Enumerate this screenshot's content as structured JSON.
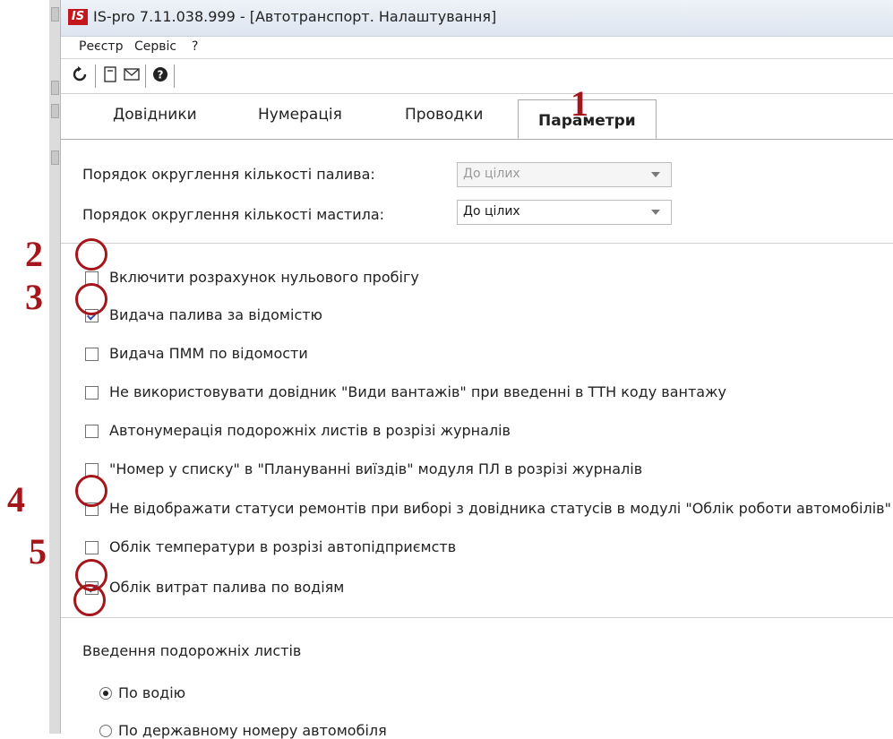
{
  "window": {
    "title": "IS-pro 7.11.038.999 - [Автотранспорт. Налаштування]",
    "logo": "IS"
  },
  "menu": [
    "Реєстр",
    "Сервіс",
    "?"
  ],
  "toolbar": {
    "icons": [
      "refresh-icon",
      "form-icon",
      "mail-icon",
      "help-icon"
    ]
  },
  "tabs": [
    {
      "label": "Довідники",
      "active": false
    },
    {
      "label": "Нумерація",
      "active": false
    },
    {
      "label": "Проводки",
      "active": false
    },
    {
      "label": "Параметри",
      "active": true
    }
  ],
  "settings": {
    "fuel_rounding": {
      "label": "Порядок округлення кількості палива:",
      "value": "До цілих",
      "enabled": false
    },
    "oil_rounding": {
      "label": "Порядок округлення кількості мастила:",
      "value": "До цілих",
      "enabled": true
    }
  },
  "checkboxes": [
    {
      "label": "Включити розрахунок нульового пробігу",
      "checked": false
    },
    {
      "label": "Видача палива за відомістю",
      "checked": true
    },
    {
      "label": "Видача ПММ по відомости",
      "checked": false
    },
    {
      "label": "Не використовувати довідник \"Види вантажів\" при введенні в ТТН коду вантажу",
      "checked": false
    },
    {
      "label": "Автонумерація подорожніх листів в розрізі журналів",
      "checked": false
    },
    {
      "label": "\"Номер у списку\" в \"Плануванні виїздів\" модуля ПЛ в розрізі журналів",
      "checked": false
    },
    {
      "label": "Не відображати статуси ремонтів при виборі з довідника статусів в модулі \"Облік роботи автомобілів\"",
      "checked": false
    },
    {
      "label": "Облік температури в розрізі автопідприємств",
      "checked": false
    },
    {
      "label": "Облік витрат палива по водіям",
      "checked": true
    }
  ],
  "waybill_entry": {
    "label": "Введення подорожніх листів",
    "options": [
      {
        "label": "По водію",
        "selected": true
      },
      {
        "label": "По державному номеру автомобіля",
        "selected": false
      }
    ]
  },
  "annotations": [
    "1",
    "2",
    "3",
    "4",
    "5"
  ],
  "colors": {
    "annotation": "#a5161b",
    "logo": "#c4161c",
    "check": "#2d4f9a"
  }
}
